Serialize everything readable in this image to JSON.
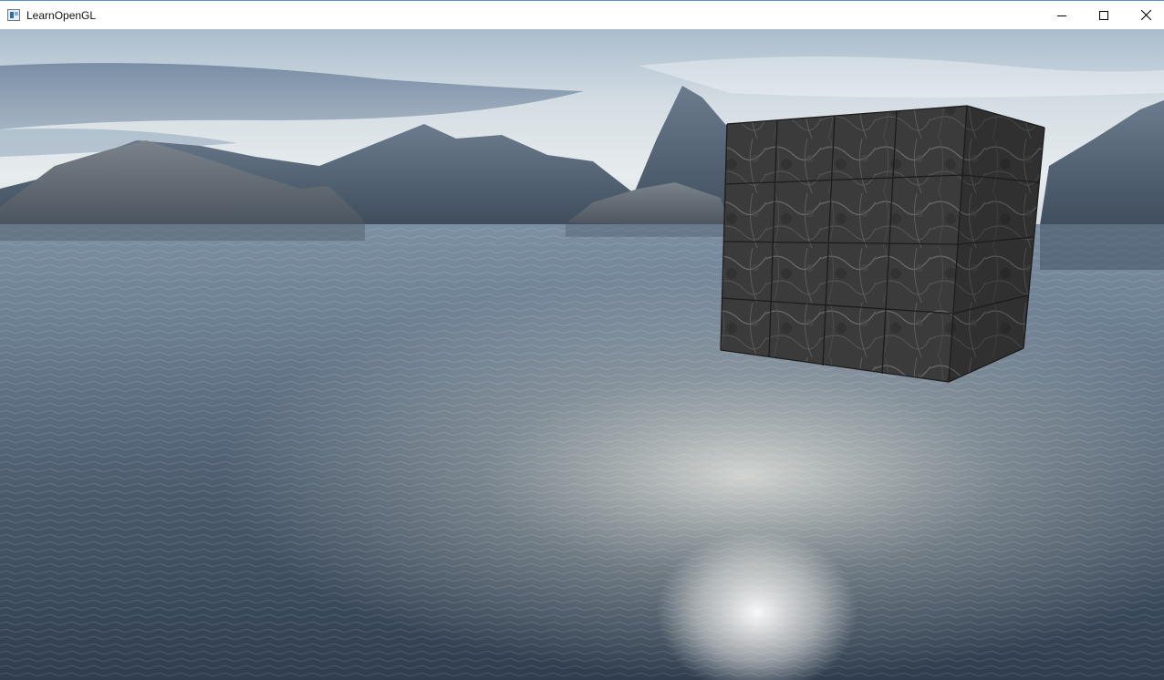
{
  "window": {
    "title": "LearnOpenGL",
    "icon": "opengl-app-icon",
    "controls": [
      "minimize-icon",
      "maximize-icon",
      "close-icon"
    ]
  },
  "scene": {
    "description_free": true,
    "colors": {
      "sky_top": "#9fb3c7",
      "sky_bottom": "#e9eef0",
      "water_dark": "#2f3f52",
      "water_light": "#b6c0c4",
      "mountain": "#56667a",
      "cube_face": "#3a3a3a"
    }
  }
}
